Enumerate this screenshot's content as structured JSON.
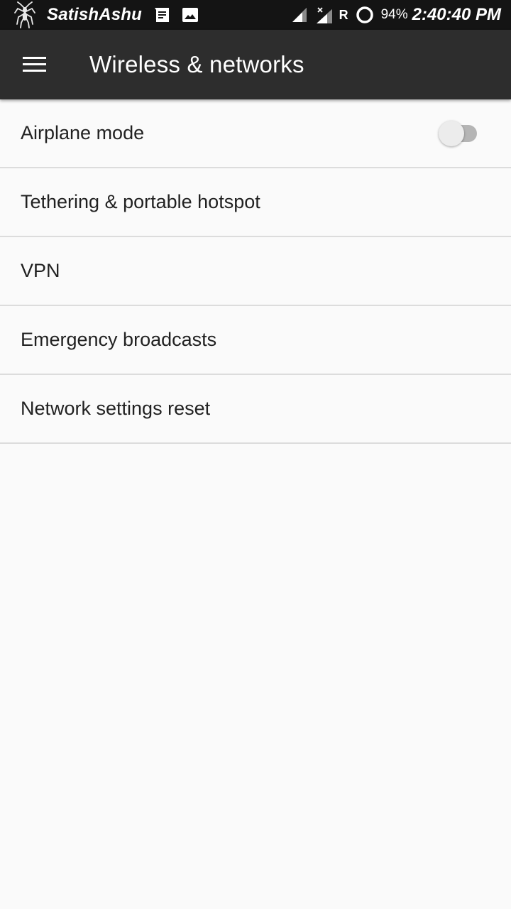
{
  "status_bar": {
    "carrier_name": "SatishAshu",
    "notification_icons": [
      "spider-logo-icon",
      "message-icon",
      "image-icon"
    ],
    "signal_icons": [
      "signal-icon",
      "signal-no-data-icon"
    ],
    "roaming_indicator": "R",
    "battery_percent": "94%",
    "time": "2:40:40 PM"
  },
  "toolbar": {
    "title": "Wireless & networks",
    "menu_icon": "hamburger-menu-icon"
  },
  "settings": {
    "items": [
      {
        "label": "Airplane mode",
        "has_toggle": true,
        "toggle_on": false
      },
      {
        "label": "Tethering & portable hotspot"
      },
      {
        "label": "VPN"
      },
      {
        "label": "Emergency broadcasts"
      },
      {
        "label": "Network settings reset"
      }
    ]
  },
  "colors": {
    "status_bar_bg": "#141414",
    "toolbar_bg": "#2d2d2d",
    "page_bg": "#fafafa",
    "divider": "#dcdcdc",
    "text_primary": "#212121",
    "toggle_track_off": "#b5b5b5",
    "toggle_thumb_off": "#ececec"
  }
}
